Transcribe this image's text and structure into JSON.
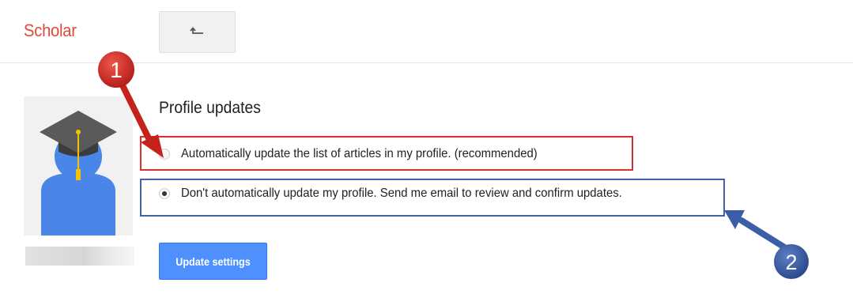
{
  "header": {
    "app_name": "Scholar",
    "back_icon": "back-arrow-icon"
  },
  "profile": {
    "section_title": "Profile updates",
    "options": [
      {
        "label": "Automatically update the list of articles in my profile. (recommended)",
        "selected": false
      },
      {
        "label": "Don't automatically update my profile. Send me email to review and confirm updates.",
        "selected": true
      }
    ],
    "update_button_label": "Update settings"
  },
  "annotations": {
    "marker_1": "1",
    "marker_2": "2"
  },
  "colors": {
    "brand_red": "#dd4b39",
    "button_blue": "#4d90fe",
    "annotation_red": "#d9302c",
    "annotation_blue": "#3f62a8"
  }
}
